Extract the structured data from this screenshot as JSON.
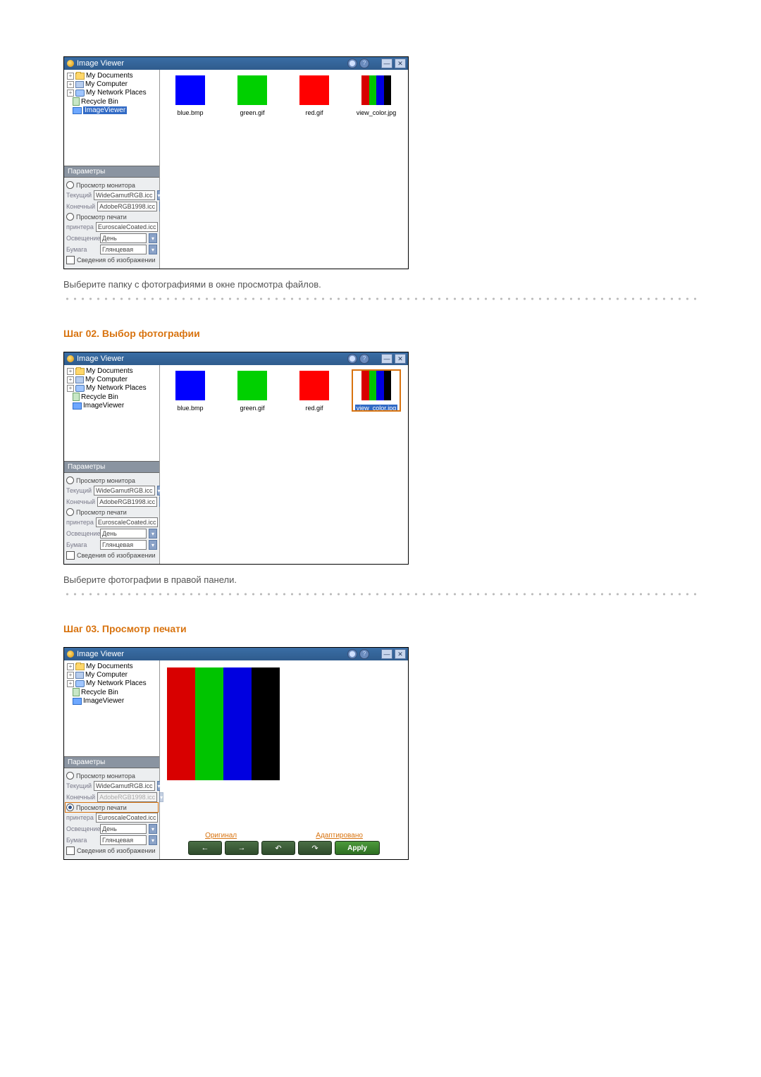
{
  "app": {
    "title": "Image Viewer"
  },
  "captions": {
    "step01": "Выберите папку с фотографиями в окне просмотра файлов.",
    "step02_title": "Шаг 02. Выбор фотографии",
    "step02": "Выберите фотографии в правой панели.",
    "step03_title": "Шаг 03. Просмотр печати"
  },
  "tree": {
    "items": [
      {
        "icon": "folder",
        "label": "My Documents",
        "expand": "+"
      },
      {
        "icon": "computer",
        "label": "My Computer",
        "expand": "+"
      },
      {
        "icon": "net",
        "label": "My Network Places",
        "expand": "+"
      },
      {
        "icon": "bin",
        "label": "Recycle Bin",
        "expand": ""
      },
      {
        "icon": "folderblue",
        "label": "ImageViewer",
        "expand": "",
        "selected": true
      }
    ]
  },
  "params": {
    "header": "Параметры",
    "monitor_radio": "Просмотр монитора",
    "print_radio": "Просмотр печати",
    "current_label": "Текущий",
    "current_value": "WideGamutRGB.icc",
    "final_label": "Конечный",
    "final_value": "AdobeRGB1998.icc",
    "printer_label": "принтера",
    "printer_value": "EuroscaleCoated.icc",
    "light_label": "Освещение",
    "light_value": "День",
    "paper_label": "Бумага",
    "paper_value": "Глянцевая",
    "info_check": "Сведения об изображении"
  },
  "thumbs": {
    "b": "blue.bmp",
    "g": "green.gif",
    "r": "red.gif",
    "v": "view_color.jpg"
  },
  "preview": {
    "orig": "Оригинал",
    "adapt": "Адаптировано",
    "apply": "Apply",
    "left": "←",
    "right": "→",
    "undo": "↶",
    "redo": "↷"
  }
}
